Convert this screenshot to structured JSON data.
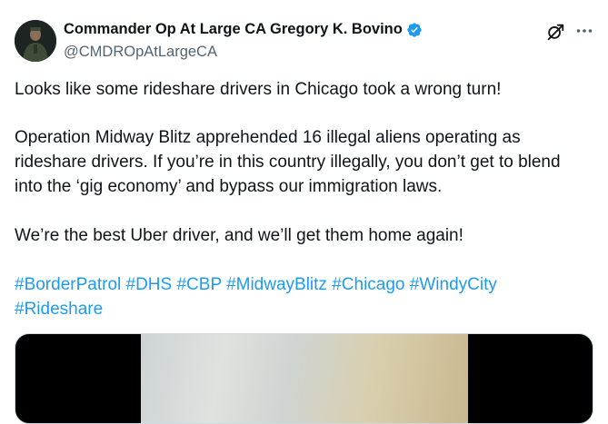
{
  "author": {
    "display_name": "Commander Op At Large CA Gregory K. Bovino",
    "handle": "@CMDROpAtLargeCA",
    "verified_icon": "verified-badge-icon",
    "verified_color": "#1d9bf0"
  },
  "actions": {
    "grok_icon": "grok-icon",
    "more_icon": "more-options-icon"
  },
  "post": {
    "paragraph_1": "Looks like some rideshare drivers in Chicago took a wrong turn!",
    "paragraph_2": "Operation Midway Blitz apprehended 16 illegal aliens operating as rideshare drivers. If you’re in this country illegally, you don’t get to blend into the ‘gig economy’ and bypass our immigration laws.",
    "paragraph_3": "We’re the best Uber driver, and we’ll get them home again!",
    "hashtags": [
      "#BorderPatrol",
      "#DHS",
      "#CBP",
      "#MidwayBlitz",
      "#Chicago",
      "#WindyCity",
      "#Rideshare"
    ],
    "hashtag_color": "#1d9bf0"
  }
}
